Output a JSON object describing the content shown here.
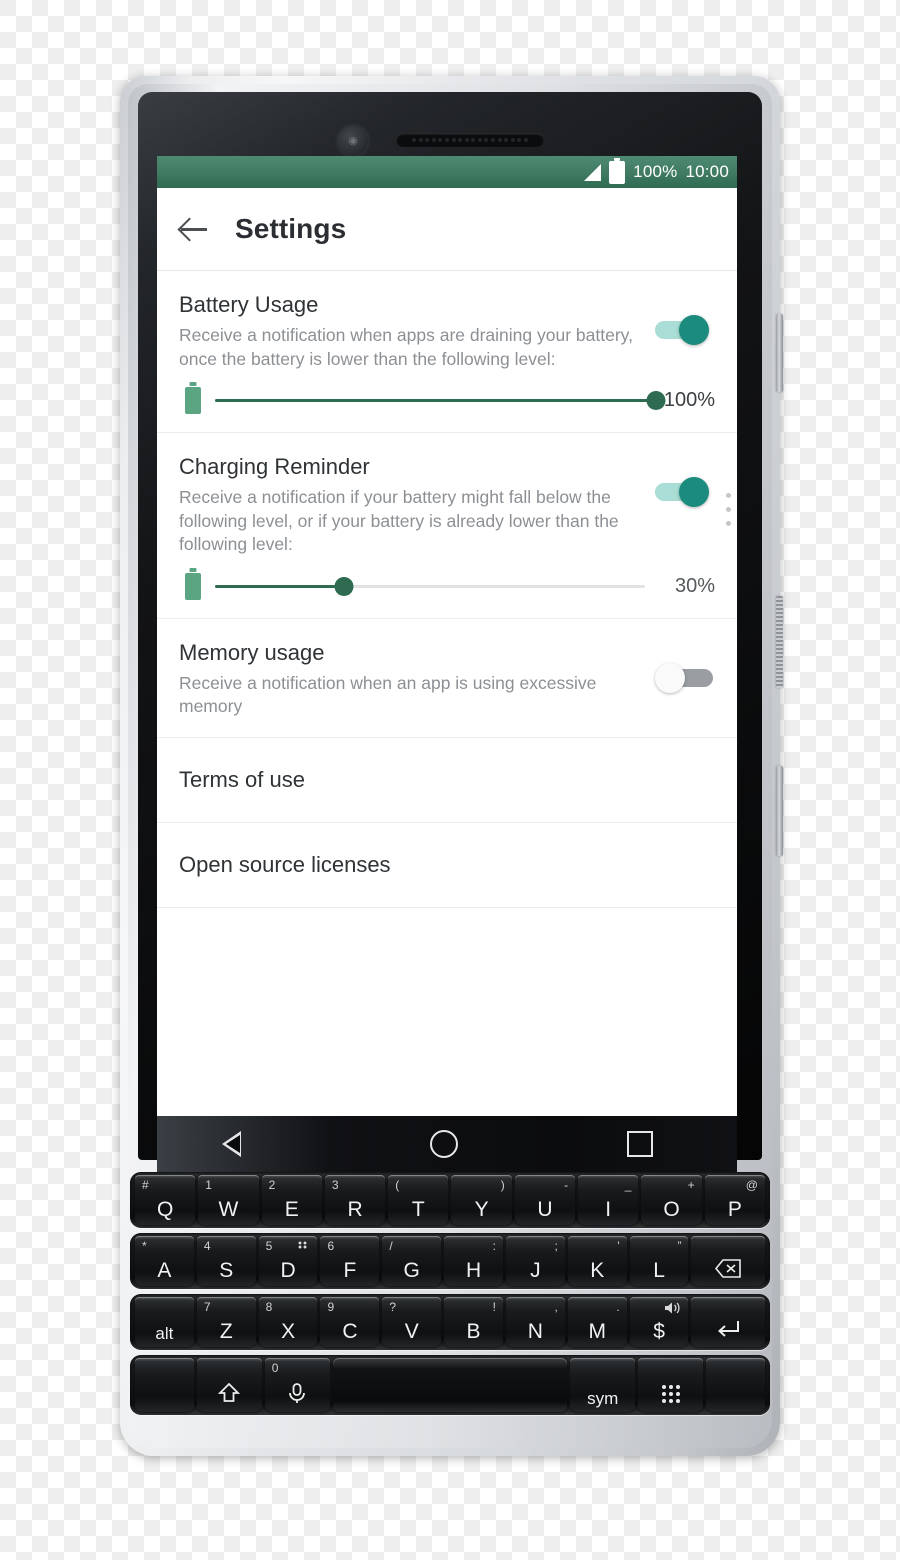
{
  "device": {
    "name": "BlackBerry KEY2 physical-keyboard phone",
    "front_camera_icon": "camera-icon",
    "earpiece_icon": "speaker-grille-icon",
    "side_buttons": [
      "volume-up-button",
      "convenience-key",
      "power-button"
    ]
  },
  "statusbar": {
    "signal_icon": "signal-bars-icon",
    "battery_icon": "battery-full-icon",
    "battery_percent": "100%",
    "time": "10:00",
    "bg_color": "#3f7a61"
  },
  "appbar": {
    "back_icon": "back-arrow-icon",
    "title": "Settings"
  },
  "settings": {
    "battery_usage": {
      "title": "Battery Usage",
      "description": "Receive a notification when apps are draining your battery, once the battery is lower than the following level:",
      "toggle_state": "on",
      "slider": {
        "icon": "battery-icon",
        "value": 100,
        "value_label": "100%",
        "min": 0,
        "max": 100
      }
    },
    "charging_reminder": {
      "title": "Charging Reminder",
      "description": "Receive a notification if your battery might fall below the following level, or if your battery is already lower than the following level:",
      "toggle_state": "on",
      "slider": {
        "icon": "battery-icon",
        "value": 30,
        "value_label": "30%",
        "min": 0,
        "max": 100
      }
    },
    "memory_usage": {
      "title": "Memory usage",
      "description": "Receive a notification when an app is using excessive memory",
      "toggle_state": "off"
    },
    "terms_of_use": {
      "title": "Terms of use"
    },
    "open_source_licenses": {
      "title": "Open source licenses"
    }
  },
  "colors": {
    "accent_teal": "#1b8b7d",
    "toggle_track_on": "#a9ddd5",
    "toggle_track_off": "#9a9ea2",
    "slider_fill": "#2e6b51",
    "battery_icon_green": "#5ba583",
    "statusbar_green": "#3f7a61",
    "title_text": "#2f3336",
    "sub_text": "#8c9094"
  },
  "navbar": {
    "back": "nav-back-triangle-icon",
    "home": "nav-home-circle-icon",
    "recents": "nav-recents-square-icon"
  },
  "keyboard": {
    "row1": [
      {
        "glyph": "Q",
        "alt": "#",
        "alt_side": "left"
      },
      {
        "glyph": "W",
        "alt": "1",
        "alt_side": "left"
      },
      {
        "glyph": "E",
        "alt": "2",
        "alt_side": "left"
      },
      {
        "glyph": "R",
        "alt": "3",
        "alt_side": "left"
      },
      {
        "glyph": "T",
        "alt": "(",
        "alt_side": "left"
      },
      {
        "glyph": "Y",
        "alt": ")",
        "alt_side": "right"
      },
      {
        "glyph": "U",
        "alt": "-",
        "alt_side": "right"
      },
      {
        "glyph": "I",
        "alt": "_",
        "alt_side": "right"
      },
      {
        "glyph": "O",
        "alt": "+",
        "alt_side": "right"
      },
      {
        "glyph": "P",
        "alt": "@",
        "alt_side": "right"
      }
    ],
    "row2": [
      {
        "glyph": "A",
        "alt": "*",
        "alt_side": "left"
      },
      {
        "glyph": "S",
        "alt": "4",
        "alt_side": "left"
      },
      {
        "glyph": "D",
        "alt": "5",
        "alt_side": "left",
        "extra": "keyboard-dots-icon"
      },
      {
        "glyph": "F",
        "alt": "6",
        "alt_side": "left"
      },
      {
        "glyph": "G",
        "alt": "/",
        "alt_side": "left"
      },
      {
        "glyph": "H",
        "alt": ":",
        "alt_side": "right"
      },
      {
        "glyph": "J",
        "alt": ";",
        "alt_side": "right"
      },
      {
        "glyph": "K",
        "alt": "'",
        "alt_side": "right"
      },
      {
        "glyph": "L",
        "alt": "”",
        "alt_side": "right"
      },
      {
        "glyph": "",
        "alt": "",
        "icon": "backspace-icon"
      }
    ],
    "row3": [
      {
        "glyph": "alt",
        "alt": "",
        "small": true
      },
      {
        "glyph": "Z",
        "alt": "7",
        "alt_side": "left"
      },
      {
        "glyph": "X",
        "alt": "8",
        "alt_side": "left"
      },
      {
        "glyph": "C",
        "alt": "9",
        "alt_side": "left"
      },
      {
        "glyph": "V",
        "alt": "?",
        "alt_side": "left"
      },
      {
        "glyph": "B",
        "alt": "!",
        "alt_side": "right"
      },
      {
        "glyph": "N",
        "alt": ",",
        "alt_side": "right"
      },
      {
        "glyph": "M",
        "alt": ".",
        "alt_side": "right"
      },
      {
        "glyph": "$",
        "alt": "",
        "alt_side": "right",
        "icon_alt": "speaker-icon"
      },
      {
        "glyph": "",
        "alt": "",
        "icon": "enter-icon"
      }
    ],
    "row4": [
      {
        "glyph": "",
        "alt": "",
        "icon": "blank-key"
      },
      {
        "glyph": "",
        "alt": "",
        "icon": "shift-icon"
      },
      {
        "glyph": "",
        "alt": "0",
        "alt_side": "left",
        "icon": "microphone-icon"
      },
      {
        "glyph": "",
        "alt": "",
        "icon": "space-key"
      },
      {
        "glyph": "sym",
        "alt": "",
        "small": true
      },
      {
        "glyph": "",
        "alt": "",
        "icon": "app-grid-icon"
      },
      {
        "glyph": "",
        "alt": "",
        "icon": "blank-key"
      }
    ]
  }
}
